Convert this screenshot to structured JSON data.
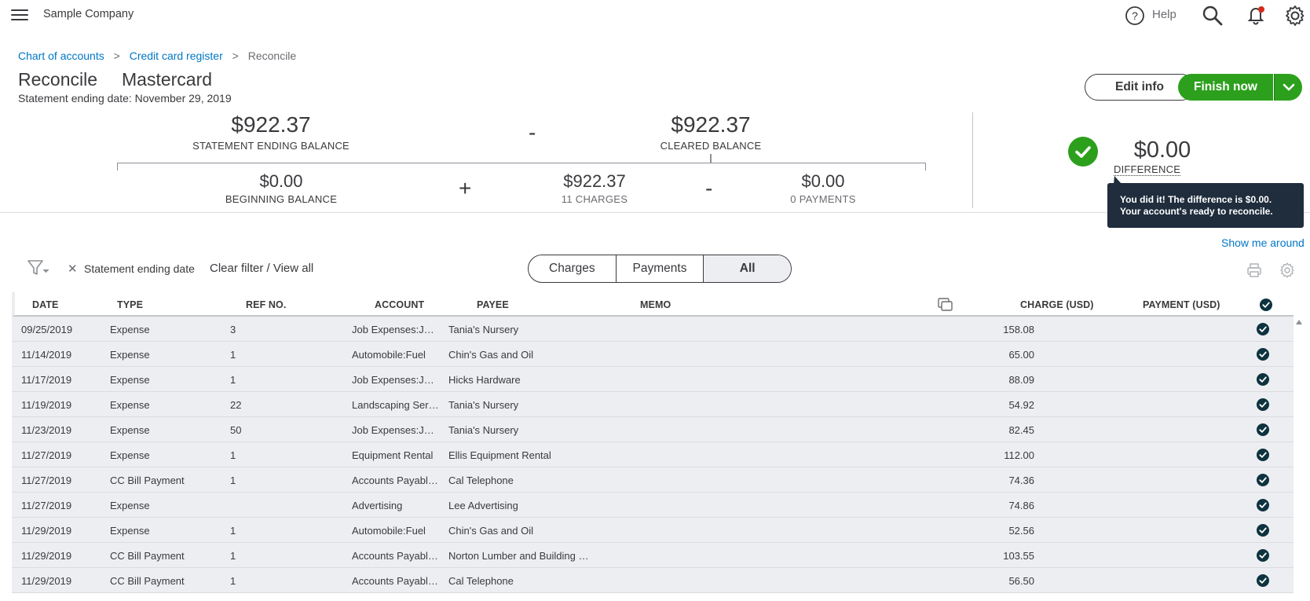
{
  "topbar": {
    "company": "Sample Company",
    "help_label": "Help"
  },
  "breadcrumb": {
    "item1": "Chart of accounts",
    "item2": "Credit card register",
    "item3": "Reconcile",
    "sep": ">"
  },
  "header": {
    "title": "Reconcile",
    "account": "Mastercard",
    "statement_date": "Statement ending date: November 29, 2019",
    "edit_label": "Edit info",
    "finish_label": "Finish now"
  },
  "summary": {
    "statement_ending_balance": "$922.37",
    "statement_ending_label": "STATEMENT ENDING BALANCE",
    "cleared_balance": "$922.37",
    "cleared_label": "CLEARED BALANCE",
    "beginning_balance": "$0.00",
    "beginning_label": "BEGINNING BALANCE",
    "charges_total": "$922.37",
    "charges_label": "11 CHARGES",
    "payments_total": "$0.00",
    "payments_label": "0 PAYMENTS",
    "difference": "$0.00",
    "difference_label": "DIFFERENCE",
    "op_minus": "-",
    "op_plus": "+"
  },
  "tooltip": {
    "text": "You did it! The difference is $0.00. Your account's ready to reconcile."
  },
  "show_me_around": "Show me around",
  "filter": {
    "chip": "Statement ending date",
    "x": "✕",
    "clear": "Clear filter / View all"
  },
  "tabs": [
    "Charges",
    "Payments",
    "All"
  ],
  "active_tab": "All",
  "table": {
    "headers": {
      "date": "DATE",
      "type": "TYPE",
      "ref": "REF NO.",
      "account": "ACCOUNT",
      "payee": "PAYEE",
      "memo": "MEMO",
      "charge": "CHARGE (USD)",
      "payment": "PAYMENT (USD)"
    },
    "rows": [
      {
        "date": "09/25/2019",
        "type": "Expense",
        "ref": "3",
        "account": "Job Expenses:J…",
        "payee": "Tania's Nursery",
        "charge": "158.08"
      },
      {
        "date": "11/14/2019",
        "type": "Expense",
        "ref": "1",
        "account": "Automobile:Fuel",
        "payee": "Chin's Gas and Oil",
        "charge": "65.00"
      },
      {
        "date": "11/17/2019",
        "type": "Expense",
        "ref": "1",
        "account": "Job Expenses:J…",
        "payee": "Hicks Hardware",
        "charge": "88.09"
      },
      {
        "date": "11/19/2019",
        "type": "Expense",
        "ref": "22",
        "account": "Landscaping Ser…",
        "payee": "Tania's Nursery",
        "charge": "54.92"
      },
      {
        "date": "11/23/2019",
        "type": "Expense",
        "ref": "50",
        "account": "Job Expenses:J…",
        "payee": "Tania's Nursery",
        "charge": "82.45"
      },
      {
        "date": "11/27/2019",
        "type": "Expense",
        "ref": "1",
        "account": "Equipment Rental",
        "payee": "Ellis Equipment Rental",
        "charge": "112.00"
      },
      {
        "date": "11/27/2019",
        "type": "CC Bill Payment",
        "ref": "1",
        "account": "Accounts Payabl…",
        "payee": "Cal Telephone",
        "charge": "74.36"
      },
      {
        "date": "11/27/2019",
        "type": "Expense",
        "ref": "",
        "account": "Advertising",
        "payee": "Lee Advertising",
        "charge": "74.86"
      },
      {
        "date": "11/29/2019",
        "type": "Expense",
        "ref": "1",
        "account": "Automobile:Fuel",
        "payee": "Chin's Gas and Oil",
        "charge": "52.56"
      },
      {
        "date": "11/29/2019",
        "type": "CC Bill Payment",
        "ref": "1",
        "account": "Accounts Payabl…",
        "payee": "Norton Lumber and Building …",
        "charge": "103.55"
      },
      {
        "date": "11/29/2019",
        "type": "CC Bill Payment",
        "ref": "1",
        "account": "Accounts Payabl…",
        "payee": "Cal Telephone",
        "charge": "56.50"
      }
    ]
  },
  "colors": {
    "green": "#2ca01c",
    "link": "#0077c5",
    "tooltip_bg": "#1f2d3d",
    "row_bg": "#eceef1",
    "check": "#0d333f"
  }
}
